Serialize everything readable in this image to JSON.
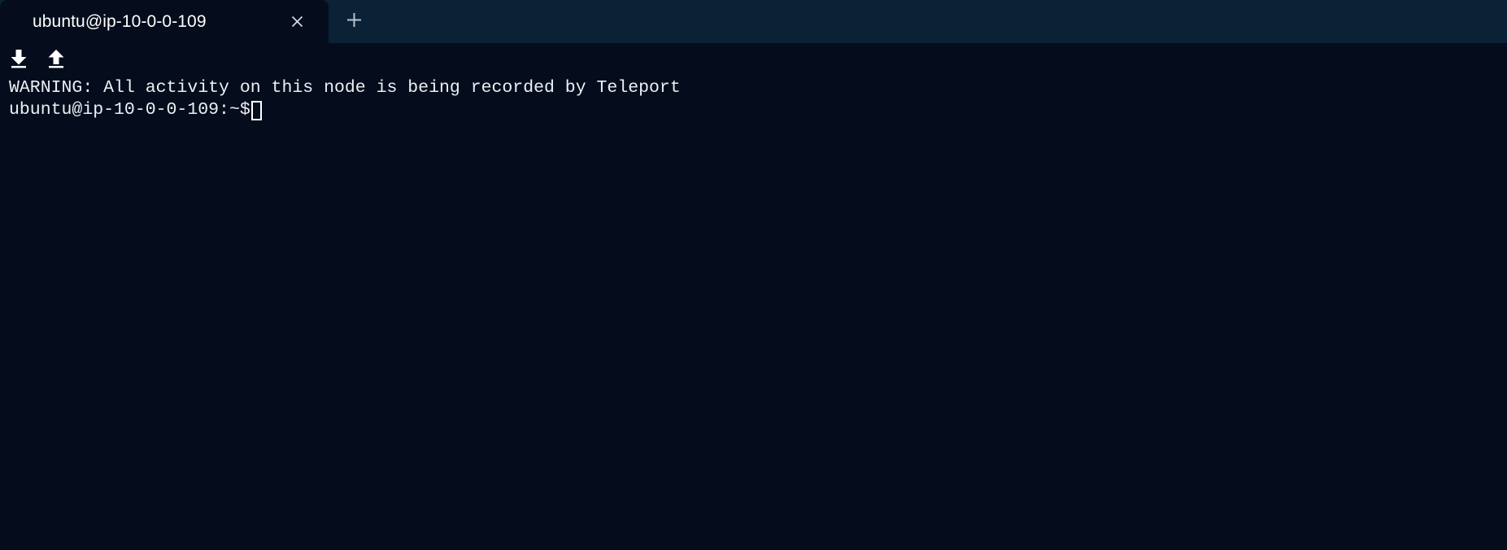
{
  "window": {
    "background_color": "#050d1c",
    "tabbar_color": "#0a2136"
  },
  "tabbar": {
    "tabs": [
      {
        "title": "ubuntu@ip-10-0-0-109",
        "active": true,
        "close_icon": "close-icon",
        "close_glyph": "×"
      }
    ],
    "new_tab": {
      "label": "+",
      "icon": "plus-icon"
    }
  },
  "transfer_bar": {
    "buttons": [
      {
        "name": "download-files-button",
        "icon": "download-icon"
      },
      {
        "name": "upload-files-button",
        "icon": "upload-icon"
      }
    ]
  },
  "terminal": {
    "lines": [
      "WARNING: All activity on this node is being recorded by Teleport"
    ],
    "prompt": "ubuntu@ip-10-0-0-109:~$",
    "input_value": "",
    "cursor_style": "hollow-block",
    "text_color": "#eceff4"
  }
}
